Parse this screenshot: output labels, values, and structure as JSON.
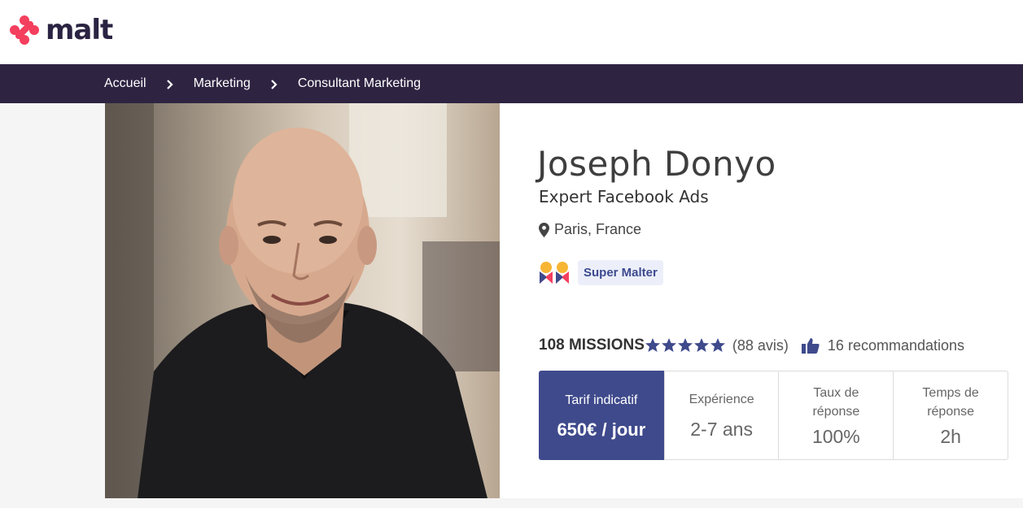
{
  "brand": {
    "name": "malt",
    "color": "#2a2342",
    "accent": "#f43f5e"
  },
  "breadcrumb": {
    "items": [
      {
        "label": "Accueil"
      },
      {
        "label": "Marketing"
      },
      {
        "label": "Consultant Marketing"
      }
    ]
  },
  "profile": {
    "name": "Joseph Donyo",
    "headline": "Expert Facebook Ads",
    "location": "Paris, France",
    "badge": "Super Malter",
    "missions": "108 MISSIONS",
    "rating_stars": 5,
    "reviews": "(88 avis)",
    "recommendations": "16 recommandations"
  },
  "cards": {
    "rate": {
      "label": "Tarif indicatif",
      "value": "650€ / jour"
    },
    "experience": {
      "label": "Expérience",
      "value": "2-7 ans"
    },
    "response_rate": {
      "label": "Taux de réponse",
      "value": "100%"
    },
    "response_time": {
      "label": "Temps de réponse",
      "value": "2h"
    }
  },
  "colors": {
    "nav_bg": "#2e2442",
    "rate_card_bg": "#3f4a8c",
    "star": "#3f4a8c",
    "badge_bg": "#eceff9"
  },
  "icons": [
    "malt-logo-icon",
    "chevron-right-icon",
    "location-pin-icon",
    "super-malter-icon",
    "star-icon",
    "thumbs-up-icon"
  ]
}
